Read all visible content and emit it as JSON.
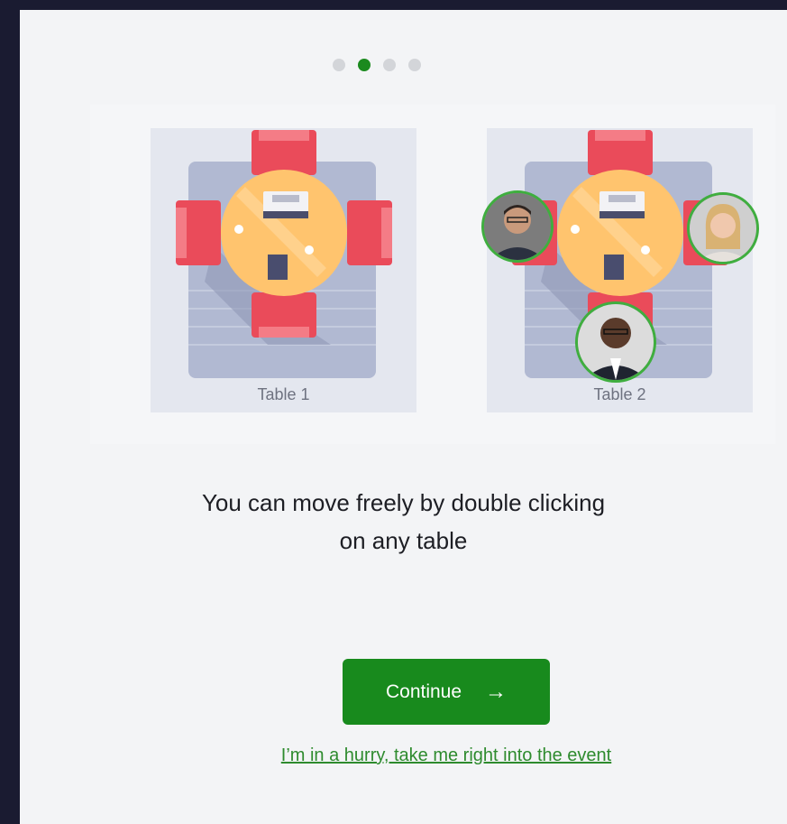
{
  "stepper": {
    "total": 4,
    "active_index": 1
  },
  "tables": [
    {
      "label": "Table 1"
    },
    {
      "label": "Table 2"
    }
  ],
  "headline": {
    "line1": "You can move freely by double clicking",
    "line2": "on any table"
  },
  "actions": {
    "continue_label": "Continue",
    "continue_icon": "→",
    "hurry_link": "I’m in a hurry, take me right into the event"
  },
  "colors": {
    "accent": "#188a1d",
    "link": "#2e8b2e",
    "chair": "#ea4b5a",
    "table_top": "#ffc46e",
    "avatar_ring": "#3fae3f"
  }
}
